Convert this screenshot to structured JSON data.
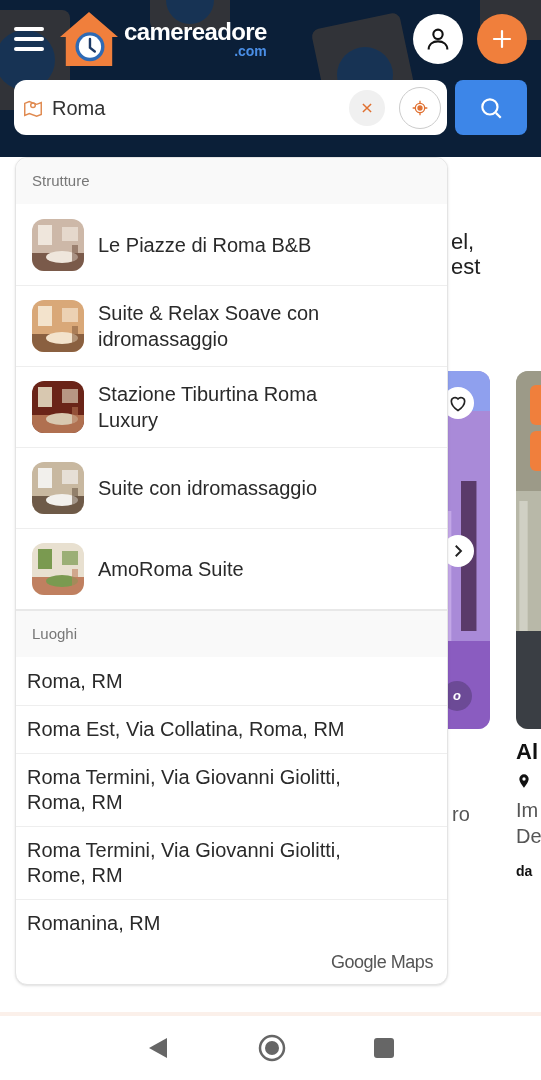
{
  "header": {
    "logo": {
      "name": "camereadore",
      "suffix": ".com"
    }
  },
  "search": {
    "value": "Roma"
  },
  "dropdown": {
    "sections": [
      {
        "title": "Strutture",
        "kind": "property",
        "items": [
          {
            "name": "Le Piazze di Roma B&B"
          },
          {
            "name": "Suite & Relax Soave con idromassaggio"
          },
          {
            "name": "Stazione Tiburtina Roma Luxury"
          },
          {
            "name": "Suite con idromassaggio"
          },
          {
            "name": "AmoRoma Suite"
          }
        ]
      },
      {
        "title": "Luoghi",
        "kind": "place",
        "items": [
          {
            "name": "Roma, RM"
          },
          {
            "name": "Roma Est, Via Collatina, Roma, RM"
          },
          {
            "name": "Roma Termini, Via Giovanni Giolitti, Roma, RM"
          },
          {
            "name": "Roma Termini, Via Giovanni Giolitti, Rome, RM"
          },
          {
            "name": "Romanina, RM"
          }
        ]
      }
    ],
    "attribution": "Google Maps"
  },
  "background": {
    "intro_lines": [
      "el,",
      "est"
    ],
    "cards": [
      {
        "badge": "o",
        "lines": [
          "ro"
        ]
      },
      {
        "title": "Al",
        "lines": [
          "Im",
          "De"
        ],
        "price": "da"
      }
    ]
  }
}
